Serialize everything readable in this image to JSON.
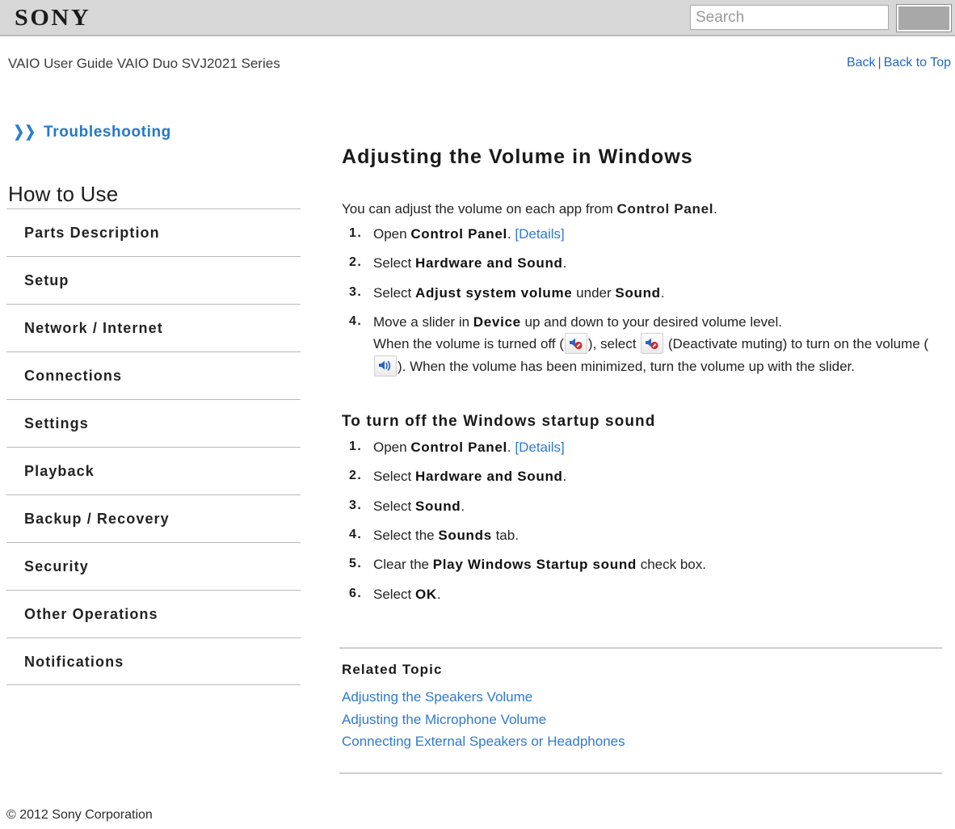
{
  "header": {
    "logo_text": "SONY",
    "search": {
      "placeholder": "Search",
      "value": "",
      "button_label": ""
    }
  },
  "titlebar": {
    "guide_title": "VAIO User Guide VAIO Duo SVJ2021 Series",
    "back_label": "Back",
    "separator": "|",
    "back_to_top_label": "Back to Top"
  },
  "sidebar": {
    "troubleshooting_label": "Troubleshooting",
    "chevron_icon": "chevron-double-right-icon",
    "how_to_use_label": "How to Use",
    "items": [
      {
        "label": "Parts Description"
      },
      {
        "label": "Setup"
      },
      {
        "label": "Network / Internet"
      },
      {
        "label": "Connections"
      },
      {
        "label": "Settings"
      },
      {
        "label": "Playback"
      },
      {
        "label": "Backup / Recovery"
      },
      {
        "label": "Security"
      },
      {
        "label": "Other Operations"
      },
      {
        "label": "Notifications"
      }
    ]
  },
  "main": {
    "page_title": "Adjusting the Volume in Windows",
    "intro": {
      "before": "You can adjust the volume on each app from ",
      "bold": "Control Panel",
      "after": "."
    },
    "steps": [
      {
        "t1": "Open ",
        "b1": "Control Panel",
        "t2": ". ",
        "link": "[Details]"
      },
      {
        "t1": "Select ",
        "b1": "Hardware and Sound",
        "t2": "."
      },
      {
        "t1": "Select ",
        "b1": "Adjust system volume",
        "t2": " under ",
        "b2": "Sound",
        "t3": "."
      },
      {
        "t1": "Move a slider in ",
        "b1": "Device",
        "t2": " up and down to your desired volume level.",
        "l2a": "When the volume is turned off (",
        "icon1": "volume-mute-icon",
        "l2b": "), select ",
        "icon2": "volume-mute-icon",
        "l2c": " (Deactivate muting) to turn on the volume (",
        "icon3": "volume-on-icon",
        "l2d": "). When the volume has been minimized, turn the volume up with the slider."
      }
    ],
    "section2": {
      "heading": "To turn off the Windows startup sound",
      "steps": [
        {
          "t1": "Open ",
          "b1": "Control Panel",
          "t2": ". ",
          "link": "[Details]"
        },
        {
          "t1": "Select ",
          "b1": "Hardware and Sound",
          "t2": "."
        },
        {
          "t1": "Select ",
          "b1": "Sound",
          "t2": "."
        },
        {
          "t1": "Select the ",
          "b1": "Sounds",
          "t2": " tab."
        },
        {
          "t1": "Clear the ",
          "b1": "Play Windows Startup sound",
          "t2": " check box."
        },
        {
          "t1": "Select ",
          "b1": "OK",
          "t2": "."
        }
      ]
    },
    "related": {
      "heading": "Related Topic",
      "links": [
        "Adjusting the Speakers Volume",
        "Adjusting the Microphone Volume",
        "Connecting External Speakers or Headphones"
      ]
    }
  },
  "footer": {
    "copyright": "© 2012 Sony Corporation"
  },
  "colors": {
    "link": "#2f7ad0",
    "header_bg": "#d7d7d7",
    "accent_blue": "#2379c8",
    "mute_red": "#d22a2a",
    "speaker_blue": "#2b62c6"
  }
}
